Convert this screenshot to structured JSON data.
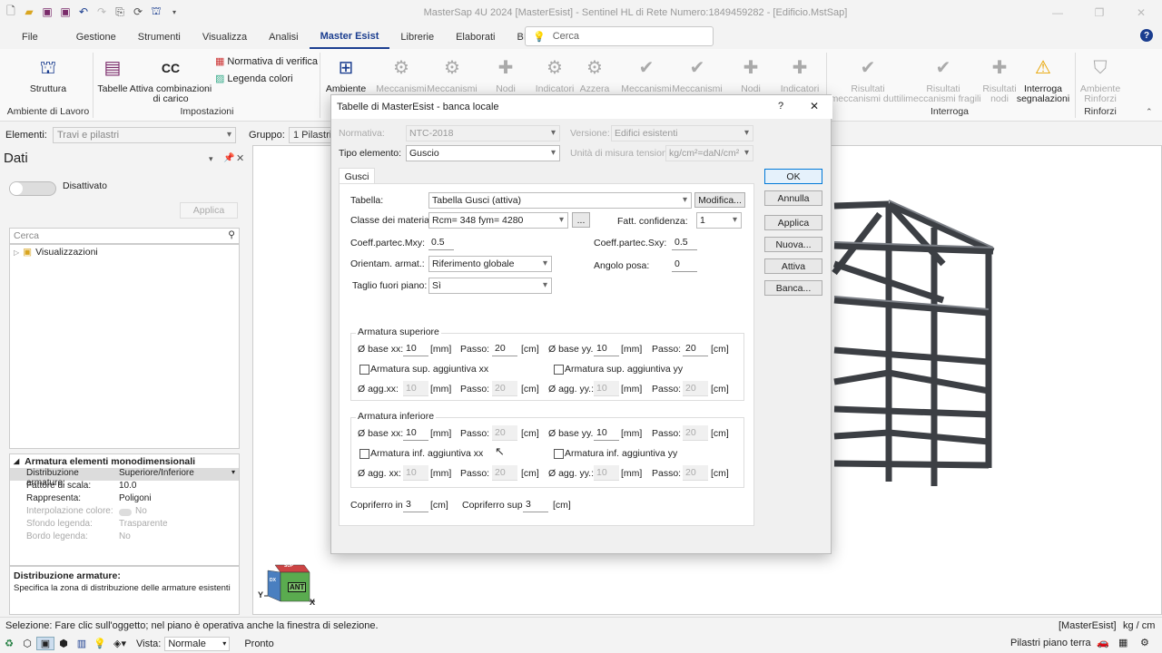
{
  "window": {
    "title": "MasterSap 4U 2024 [MasterEsist] - Sentinel HL di Rete Numero:1849459282 - [Edificio.MstSap]",
    "controls": [
      "—",
      "❐",
      "✕"
    ]
  },
  "menu": {
    "items": [
      "File",
      "Gestione",
      "Strumenti",
      "Visualizza",
      "Analisi",
      "Master Esist",
      "Librerie",
      "Elaborati",
      "BIM"
    ],
    "search_placeholder": "Cerca",
    "help": "?"
  },
  "ribbon": {
    "struttura": "Struttura",
    "tabelle": "Tabelle",
    "attiva_comb": "Attiva combinazioni\ndi carico",
    "normativa": "Normativa di verifica",
    "legenda": "Legenda colori",
    "ambiente": "Ambiente",
    "meccanismi1": "Meccanismi",
    "meccanismi2": "Meccanismi",
    "nodi1": "Nodi",
    "indicatori1": "Indicatori",
    "azzera": "Azzera",
    "meccanismi3": "Meccanismi",
    "meccanismi4": "Meccanismi",
    "nodi2": "Nodi",
    "indicatori2": "Indicatori",
    "ris_duttili": "Risultati\nmeccanismi duttili",
    "ris_fragili": "Risultati\nmeccanismi fragili",
    "ris_nodi": "Risultati\nnodi",
    "interroga_segn": "Interroga\nsegnalazioni",
    "ambiente_rinforzi": "Ambiente\nRinforzi",
    "grp_ambiente": "Ambiente di Lavoro",
    "grp_impostazioni": "Impostazioni",
    "grp_interroga": "Interroga",
    "grp_rinforzi": "Rinforzi"
  },
  "elements_bar": {
    "elementi_label": "Elementi:",
    "elementi_value": "Travi e pilastri",
    "gruppo_label": "Gruppo:",
    "gruppo_value": "1 Pilastri"
  },
  "left_panel": {
    "title": "Dati",
    "toggle_state": "Disattivato",
    "applica": "Applica",
    "search_placeholder": "Cerca",
    "tree_item": "Visualizzazioni",
    "prop_group": "Armatura elementi monodimensionali",
    "props": [
      {
        "k": "Distribuzione armature:",
        "v": "Superiore/Inferiore",
        "dis": false
      },
      {
        "k": "Fattore di scala:",
        "v": "10.0",
        "dis": false
      },
      {
        "k": "Rappresenta:",
        "v": "Poligoni",
        "dis": false
      },
      {
        "k": "Interpolazione colore:",
        "v": "No",
        "dis": true
      },
      {
        "k": "Sfondo legenda:",
        "v": "Trasparente",
        "dis": true
      },
      {
        "k": "Bordo legenda:",
        "v": "No",
        "dis": true
      }
    ],
    "desc_title": "Distribuzione armature:",
    "desc_text": "Specifica la zona di distribuzione delle armature esistenti"
  },
  "viewcube": {
    "front": "ANT",
    "top": "SUP",
    "left": "DX",
    "axis_y": "Y",
    "axis_x": "X"
  },
  "dialog": {
    "title": "Tabelle di MasterEsist - banca locale",
    "help": "?",
    "close": "✕",
    "normativa_label": "Normativa:",
    "normativa_value": "NTC-2018",
    "versione_label": "Versione:",
    "versione_value": "Edifici esistenti",
    "tipo_label": "Tipo elemento:",
    "tipo_value": "Guscio",
    "unita_label": "Unità di misura tensioni:",
    "unita_value": "kg/cm²=daN/cm²",
    "tab": "Gusci",
    "tabella_label": "Tabella:",
    "tabella_value": "Tabella Gusci (attiva)",
    "modifica": "Modifica...",
    "classe_label": "Classe dei materiali:",
    "classe_value": "Rcm= 348 fym= 4280",
    "dots": "...",
    "fatt_label": "Fatt. confidenza:",
    "fatt_value": "1",
    "mxy_label": "Coeff.partec.Mxy:",
    "mxy_value": "0.5",
    "sxy_label": "Coeff.partec.Sxy:",
    "sxy_value": "0.5",
    "orient_label": "Orientam. armat.:",
    "orient_value": "Riferimento globale",
    "angolo_label": "Angolo posa:",
    "angolo_value": "0",
    "taglio_label": "Taglio fuori piano:",
    "taglio_value": "Sì",
    "sup_title": "Armatura superiore",
    "inf_title": "Armatura inferiore",
    "base_xx": "Ø base xx:",
    "base_yy": "Ø base yy.:",
    "agg_xx": "Ø agg.xx:",
    "agg_xx_inf": "Ø agg. xx:",
    "agg_yy": "Ø agg. yy.:",
    "passo": "Passo:",
    "mm": "[mm]",
    "cm": "[cm]",
    "sup_base_xx": "10",
    "sup_passo_xx": "20",
    "sup_base_yy": "10",
    "sup_passo_yy": "20",
    "sup_chk_xx": "Armatura sup. aggiuntiva xx",
    "sup_chk_yy": "Armatura sup. aggiuntiva yy",
    "sup_agg_xx": "10",
    "sup_agg_passo_xx": "20",
    "sup_agg_yy": "10",
    "sup_agg_passo_yy": "20",
    "inf_base_xx": "10",
    "inf_passo_xx": "20",
    "inf_base_yy": "10",
    "inf_passo_yy": "20",
    "inf_chk_xx": "Armatura inf. aggiuntiva xx",
    "inf_chk_yy": "Armatura inf. aggiuntiva yy",
    "inf_agg_xx": "10",
    "inf_agg_passo_xx": "20",
    "inf_agg_yy": "10",
    "inf_agg_passo_yy": "20",
    "copri_inf_label": "Copriferro inf.",
    "copri_inf_value": "3",
    "copri_sup_label": "Copriferro sup.",
    "copri_sup_value": "3",
    "buttons": {
      "ok": "OK",
      "annulla": "Annulla",
      "applica": "Applica",
      "nuova": "Nuova...",
      "attiva": "Attiva",
      "banca": "Banca..."
    }
  },
  "status": {
    "message": "Selezione: Fare clic sull'oggetto; nel piano è operativa anche la finestra di selezione.",
    "module": "[MasterEsist]",
    "units": "kg / cm",
    "vista_label": "Vista:",
    "vista_value": "Normale",
    "ready": "Pronto",
    "view_name": "Pilastri piano terra"
  }
}
